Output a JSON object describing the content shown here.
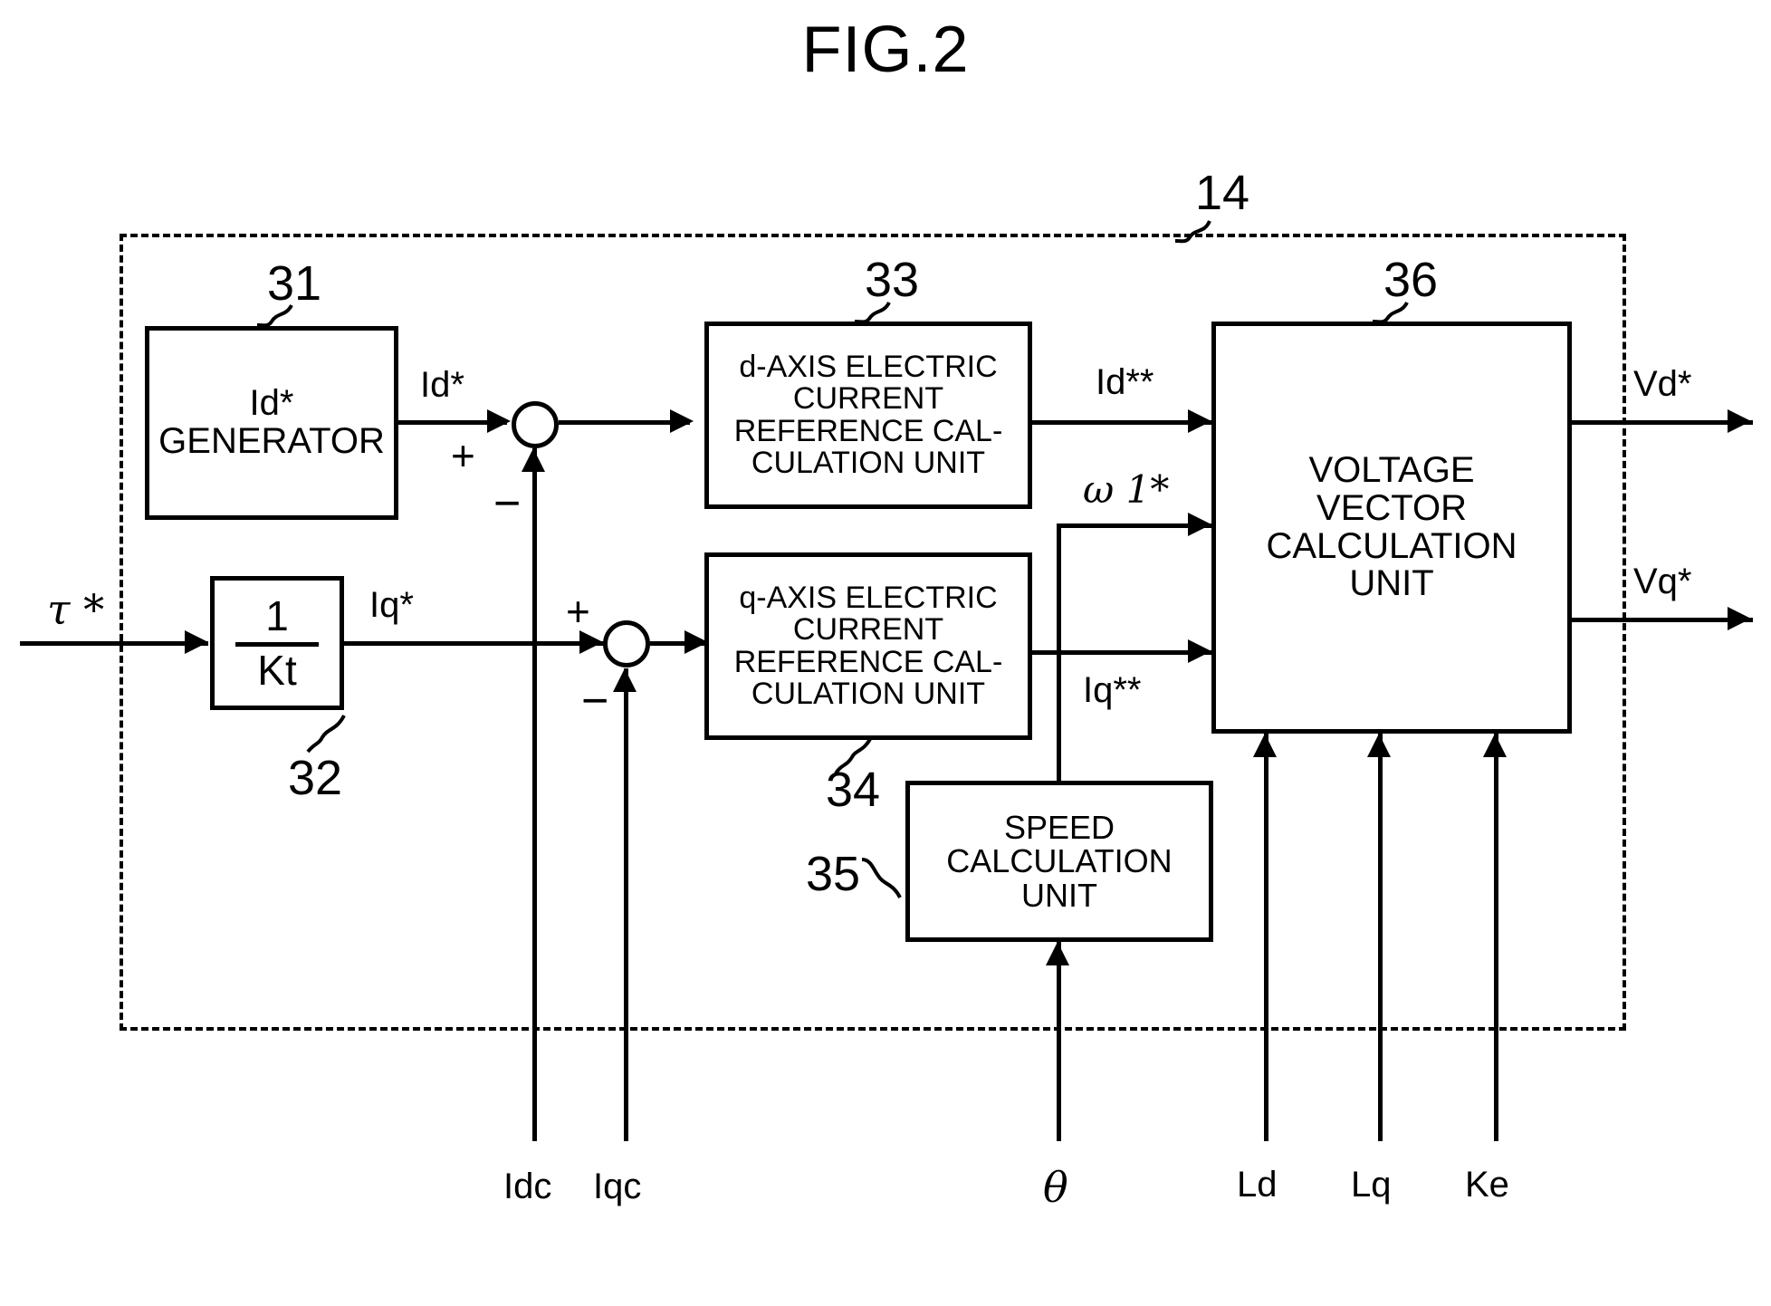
{
  "figure": {
    "title": "FIG.2",
    "outer_reference": "14"
  },
  "blocks": [
    {
      "id": "31",
      "ref": "31",
      "lines": [
        "Id*",
        "GENERATOR"
      ]
    },
    {
      "id": "32",
      "ref": "32",
      "lines": [
        "1",
        "Kt"
      ],
      "numerator": "1",
      "denominator": "Kt"
    },
    {
      "id": "33",
      "ref": "33",
      "lines": [
        "d-AXIS ELECTRIC",
        "CURRENT",
        "REFERENCE CAL-",
        "CULATION UNIT"
      ]
    },
    {
      "id": "34",
      "ref": "34",
      "lines": [
        "q-AXIS ELECTRIC",
        "CURRENT",
        "REFERENCE CAL-",
        "CULATION UNIT"
      ]
    },
    {
      "id": "35",
      "ref": "35",
      "lines": [
        "SPEED",
        "CALCULATION",
        "UNIT"
      ]
    },
    {
      "id": "36",
      "ref": "36",
      "lines": [
        "VOLTAGE",
        "VECTOR",
        "CALCULATION",
        "UNIT"
      ]
    }
  ],
  "signals": {
    "torque_ref": "τ *",
    "id_ref": "Id*",
    "iq_ref": "Iq*",
    "id_ref2": "Id**",
    "iq_ref2": "Iq**",
    "omega1_ref": "ω 1*",
    "vd_ref": "Vd*",
    "vq_ref": "Vq*",
    "idc": "Idc",
    "iqc": "Iqc",
    "theta": "θ",
    "ld": "Ld",
    "lq": "Lq",
    "ke": "Ke"
  },
  "signs": {
    "plus": "+",
    "minus": "−"
  },
  "colors": {
    "line": "#000000",
    "background": "#ffffff"
  }
}
